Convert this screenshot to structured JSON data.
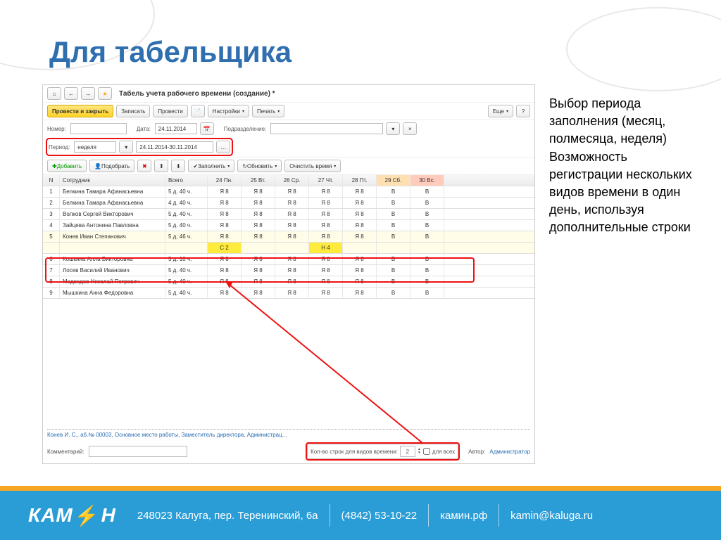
{
  "slide": {
    "title": "Для табельщика",
    "side_text": "Выбор периода заполнения (месяц, полмесяца, неделя) Возможность регистрации нескольких видов времени в один день, используя дополнительные строки"
  },
  "app": {
    "window_title": "Табель учета рабочего времени (создание) *",
    "toolbar1": {
      "save_close": "Провести и закрыть",
      "save": "Записать",
      "post": "Провести",
      "settings": "Настройки",
      "print": "Печать",
      "more": "Еще"
    },
    "fields": {
      "number_lbl": "Номер:",
      "date_lbl": "Дата:",
      "date_val": "24.11.2014",
      "dept_lbl": "Подразделение:",
      "period_lbl": "Период:",
      "period_val": "неделя",
      "period_range": "24.11.2014-30.11.2014"
    },
    "toolbar2": {
      "add": "Добавить",
      "pick": "Подобрать",
      "fill": "Заполнить",
      "refresh": "Обновить",
      "clear": "Очистить время"
    },
    "table": {
      "headers": {
        "n": "N",
        "emp": "Сотрудник",
        "total": "Всего",
        "d1": "24 Пн.",
        "d2": "25 Вт.",
        "d3": "26 Ср.",
        "d4": "27 Чт.",
        "d5": "28 Пт.",
        "d6": "29 Сб.",
        "d7": "30 Вс."
      },
      "rows": [
        {
          "n": "1",
          "name": "Белкина Тамара Афанасьевна",
          "total": "5 д. 40 ч.",
          "d": [
            "Я 8",
            "Я 8",
            "Я 8",
            "Я 8",
            "Я 8",
            "В",
            "В"
          ]
        },
        {
          "n": "2",
          "name": "Белкина Тамара Афанасьевна",
          "total": "4 д. 40 ч.",
          "d": [
            "Я 8",
            "Я 8",
            "Я 8",
            "Я 8",
            "Я 8",
            "В",
            "В"
          ]
        },
        {
          "n": "3",
          "name": "Волков Сергей Викторович",
          "total": "5 д. 40 ч.",
          "d": [
            "Я 8",
            "Я 8",
            "Я 8",
            "Я 8",
            "Я 8",
            "В",
            "В"
          ]
        },
        {
          "n": "4",
          "name": "Зайцева Антонина Павловна",
          "total": "5 д. 40 ч.",
          "d": [
            "Я 8",
            "Я 8",
            "Я 8",
            "Я 8",
            "Я 8",
            "В",
            "В"
          ]
        },
        {
          "n": "5",
          "name": "Конев Иван Степанович",
          "total": "5 д. 46 ч.",
          "d": [
            "Я 8",
            "Я 8",
            "Я 8",
            "Я 8",
            "Я 8",
            "В",
            "В"
          ],
          "sel": true
        },
        {
          "sub": true,
          "d": [
            "С 2",
            "",
            "",
            "Н 4",
            "",
            "",
            ""
          ]
        },
        {
          "n": "6",
          "name": "Кошкина Алла Викторовна",
          "total": "5 д. 10 ч.",
          "d": [
            "Я 8",
            "Я 8",
            "Я 8",
            "Я 8",
            "Я 8",
            "В",
            "В"
          ]
        },
        {
          "n": "7",
          "name": "Лосев Василий Иванович",
          "total": "5 д. 40 ч.",
          "d": [
            "Я 8",
            "Я 8",
            "Я 8",
            "Я 8",
            "Я 8",
            "В",
            "В"
          ]
        },
        {
          "n": "8",
          "name": "Медведев Николай Петрович",
          "total": "5 д. 40 ч.",
          "d": [
            "Я 8",
            "Я 8",
            "Я 8",
            "Я 8",
            "Я 8",
            "В",
            "В"
          ]
        },
        {
          "n": "9",
          "name": "Мышкина Анна Федоровна",
          "total": "5 д. 40 ч.",
          "d": [
            "Я 8",
            "Я 8",
            "Я 8",
            "Я 8",
            "Я 8",
            "В",
            "В"
          ]
        }
      ]
    },
    "status": "Конев И. С.,  аб.№ 00003,  Основное место работы,  Заместитель директора, Администрац...",
    "bottom": {
      "rows_lbl": "Кол-во строк для видов времени:",
      "rows_val": "2",
      "forall": "для всех",
      "comment": "Комментарий:",
      "author_lbl": "Автор:",
      "author_val": "Администратор"
    }
  },
  "footer": {
    "logo": "КАМИН",
    "address": "248023 Калуга, пер. Теренинский, 6а",
    "phone": "(4842) 53-10-22",
    "site1": "камин.рф",
    "site2": "kamin@kaluga.ru"
  }
}
